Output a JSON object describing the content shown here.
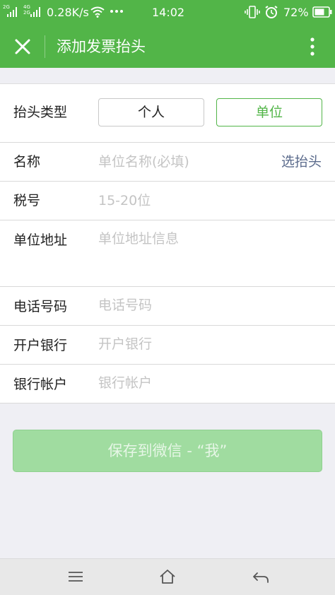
{
  "status_bar": {
    "sim1_label": "2G",
    "sim2_label": "4G\n2G",
    "network_speed": "0.28K/s",
    "time": "14:02",
    "battery_percent": "72%",
    "icons": [
      "signal-icon",
      "signal-icon",
      "wifi-icon",
      "more-dots-icon",
      "vibrate-icon",
      "alarm-icon",
      "battery-icon"
    ]
  },
  "header": {
    "title": "添加发票抬头",
    "close_icon": "close-icon",
    "menu_icon": "more-vertical-icon"
  },
  "colors": {
    "brand_green": "#52b548",
    "save_button_disabled": "#a0dca0",
    "link_blue": "#5b6b8c",
    "placeholder_gray": "#c4c4c4"
  },
  "form": {
    "type_row": {
      "label": "抬头类型",
      "options": [
        "个人",
        "单位"
      ],
      "selected": "单位"
    },
    "name_row": {
      "label": "名称",
      "placeholder": "单位名称(必填)",
      "action": "选抬头"
    },
    "tax_row": {
      "label": "税号",
      "placeholder": "15-20位"
    },
    "address_row": {
      "label": "单位地址",
      "placeholder": "单位地址信息"
    },
    "phone_row": {
      "label": "电话号码",
      "placeholder": "电话号码"
    },
    "bank_row": {
      "label": "开户银行",
      "placeholder": "开户银行"
    },
    "account_row": {
      "label": "银行帐户",
      "placeholder": "银行帐户"
    }
  },
  "save_button": {
    "label": "保存到微信 - “我”",
    "state": "disabled"
  },
  "nav_bar": {
    "icons": [
      "menu-icon",
      "home-icon",
      "back-icon"
    ]
  }
}
